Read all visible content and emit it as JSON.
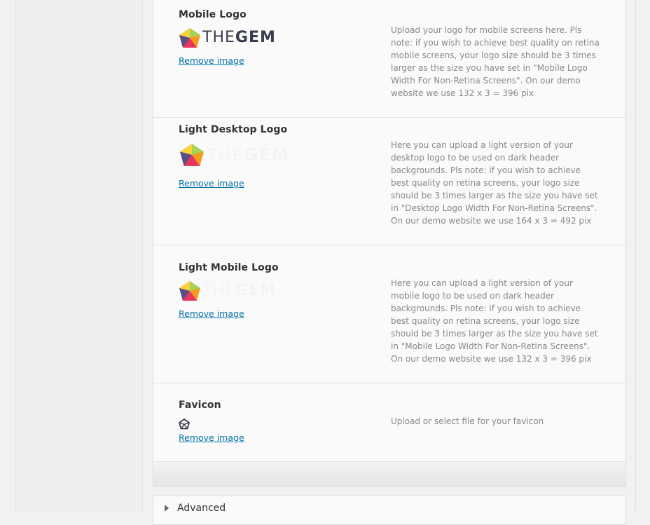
{
  "colors": {
    "link": "#0073aa",
    "heading": "#333333",
    "description": "#888888",
    "panel": "#fafafa"
  },
  "logo": {
    "text_prefix": "THE",
    "text_suffix": "GEM"
  },
  "rows": [
    {
      "title": "Mobile Logo",
      "remove": "Remove image",
      "description": "Upload your logo for mobile screens here. Pls note: if you wish to achieve best quality on retina mobile screens, your logo size should be 3 times larger as the size you have set in \"Mobile Logo Width For Non-Retina Screens\". On our demo website we use 132 x 3 = 396 pix"
    },
    {
      "title": "Light Desktop Logo",
      "remove": "Remove image",
      "description": "Here you can upload a light version of your desktop logo to be used on dark header backgrounds. Pls note: if you wish to achieve best quality on retina screens, your logo size should be 3 times larger as the size you have set in \"Desktop Logo Width For Non-Retina Screens\". On our demo website we use 164 x 3 = 492 pix"
    },
    {
      "title": "Light Mobile Logo",
      "remove": "Remove image",
      "description": "Here you can upload a light version of your mobile logo to be used on dark header backgrounds. Pls note: if you wish to achieve best quality on retina screens, your logo size should be 3 times larger as the size you have set in \"Mobile Logo Width For Non-Retina Screens\". On our demo website we use 132 x 3 = 396 pix"
    },
    {
      "title": "Favicon",
      "remove": "Remove image",
      "description": "Upload or select file for your favicon"
    }
  ],
  "advanced": {
    "label": "Advanced"
  }
}
